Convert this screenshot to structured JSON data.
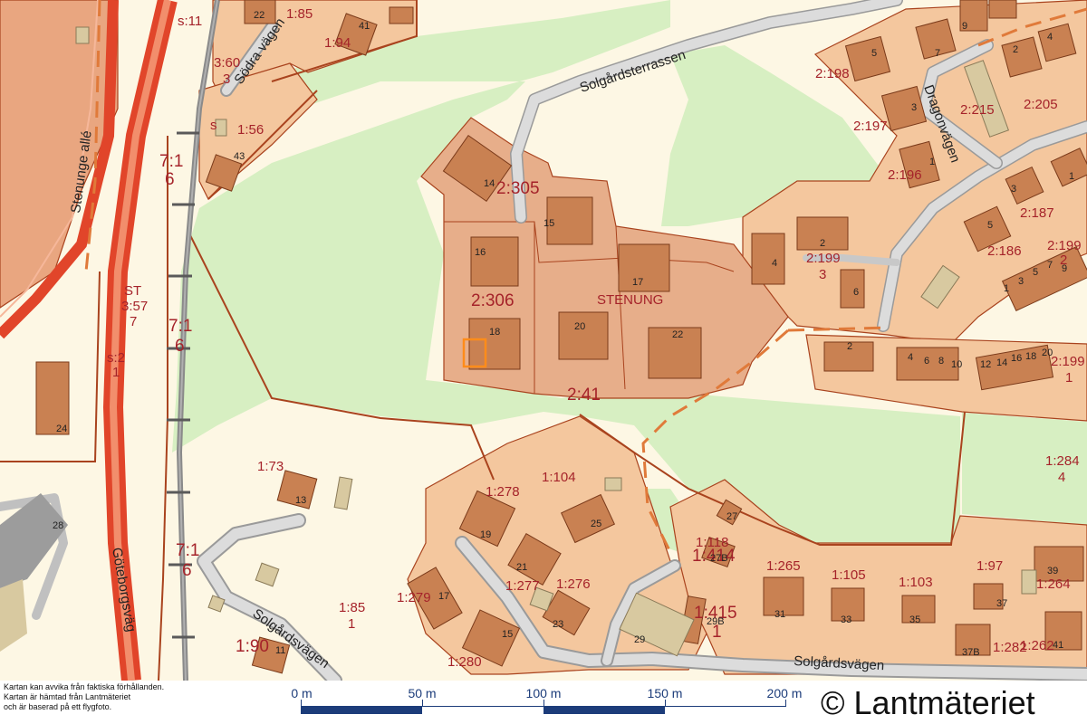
{
  "map": {
    "place_name": "STENUNG",
    "streets": {
      "stenungealle": "Stenunge allé",
      "sodra_vagen": "Södra vägen",
      "solgardsterrassen": "Solgårdsterrassen",
      "dragonvagen": "Dragonvägen",
      "goteborgsvagen": "Göteborgsväg",
      "solgardsvagen_w": "Solgårdsvägen",
      "solgardsvagen_s": "Solgårdsvägen"
    },
    "plots": {
      "p_s11": "s:11",
      "p_185": "1:85",
      "p_194": "1:94",
      "p_360a": "3:60",
      "p_360b": "3",
      "p_s": "s",
      "p_156": "1:56",
      "p_71a": "7:1",
      "p_71b": "6",
      "p_st1": "ST",
      "p_st2": "3:57",
      "p_st3": "7",
      "p_72a": "7:1",
      "p_72b": "6",
      "p_s2a": "s:2",
      "p_s2b": "1",
      "p_2305": "2:305",
      "p_2306": "2:306",
      "p_241": "2:41",
      "p_2198": "2:198",
      "p_2197": "2:197",
      "p_2196": "2:196",
      "p_2215": "2:215",
      "p_2205": "2:205",
      "p_2187": "2:187",
      "p_2186": "2:186",
      "p_2199a": "2:199",
      "p_2199b": "3",
      "p_2199c": "2:199",
      "p_2199d": "2",
      "p_2199e": "2:199",
      "p_2199f": "1",
      "p_1284a": "1:284",
      "p_1284b": "4",
      "p_173": "1:73",
      "p_1104": "1:104",
      "p_1278": "1:278",
      "p_1277": "1:277",
      "p_1276": "1:276",
      "p_1279": "1:279",
      "p_1280": "1:280",
      "p_1851a": "1:85",
      "p_1851b": "1",
      "p_190": "1:90",
      "p_73a": "7:1",
      "p_73b": "6",
      "p_1118": "1:118",
      "p_1414": "1:414",
      "p_1415a": "1:415",
      "p_1415b": "1",
      "p_1265": "1:265",
      "p_1105": "1:105",
      "p_1103": "1:103",
      "p_197": "1:97",
      "p_1264": "1:264",
      "p_1282": "1:282",
      "p_1262": "1:262"
    },
    "houses": {
      "h22a": "22",
      "h41": "41",
      "h43": "43",
      "h14": "14",
      "h15a": "15",
      "h16": "16",
      "h17a": "17",
      "h18": "18",
      "h20a": "20",
      "h22b": "22",
      "h5a": "5",
      "h3a": "3",
      "h1a": "1",
      "h9": "9",
      "h7": "7",
      "h2a": "2",
      "h4a": "4",
      "h3b": "3",
      "h5b": "5",
      "h1b": "1",
      "h3c": "3",
      "h5c": "5",
      "h7b": "7",
      "h9b": "9",
      "h1c": "1",
      "h2b": "2",
      "h4b": "4",
      "h6a": "6",
      "h2c": "2",
      "h4c": "4",
      "h6b": "6",
      "h8": "8",
      "h10": "10",
      "h12": "12",
      "h14b": "14",
      "h16b": "16",
      "h18b": "18",
      "h20b": "20",
      "h24": "24",
      "h28": "28",
      "h13": "13",
      "h19": "19",
      "h25": "25",
      "h21": "21",
      "h17b": "17",
      "h23": "23",
      "h15b": "15",
      "h11": "11",
      "h27": "27",
      "h27b": "27B",
      "h29": "29",
      "h29b": "29B",
      "h31": "31",
      "h33": "33",
      "h35": "35",
      "h37": "37",
      "h37b": "37B",
      "h39": "39",
      "h41b": "41"
    }
  },
  "footer": {
    "disclaimer": [
      "Kartan kan avvika från faktiska förhållanden.",
      "Kartan är hämtad från Lantmäteriet",
      "och är baserad på ett flygfoto."
    ],
    "scale_labels": [
      "0 m",
      "50 m",
      "100 m",
      "150 m",
      "200 m"
    ],
    "copyright": "© Lantmäteriet"
  },
  "colors": {
    "background": "#fdf7e4",
    "green": "#d7efc2",
    "plot_fill": "#f4c79e",
    "building": "#c98152",
    "boundary": "#a9431e",
    "road": "#d8d8d8",
    "highway": "#e1452a",
    "scale": "#1c3c7a"
  }
}
